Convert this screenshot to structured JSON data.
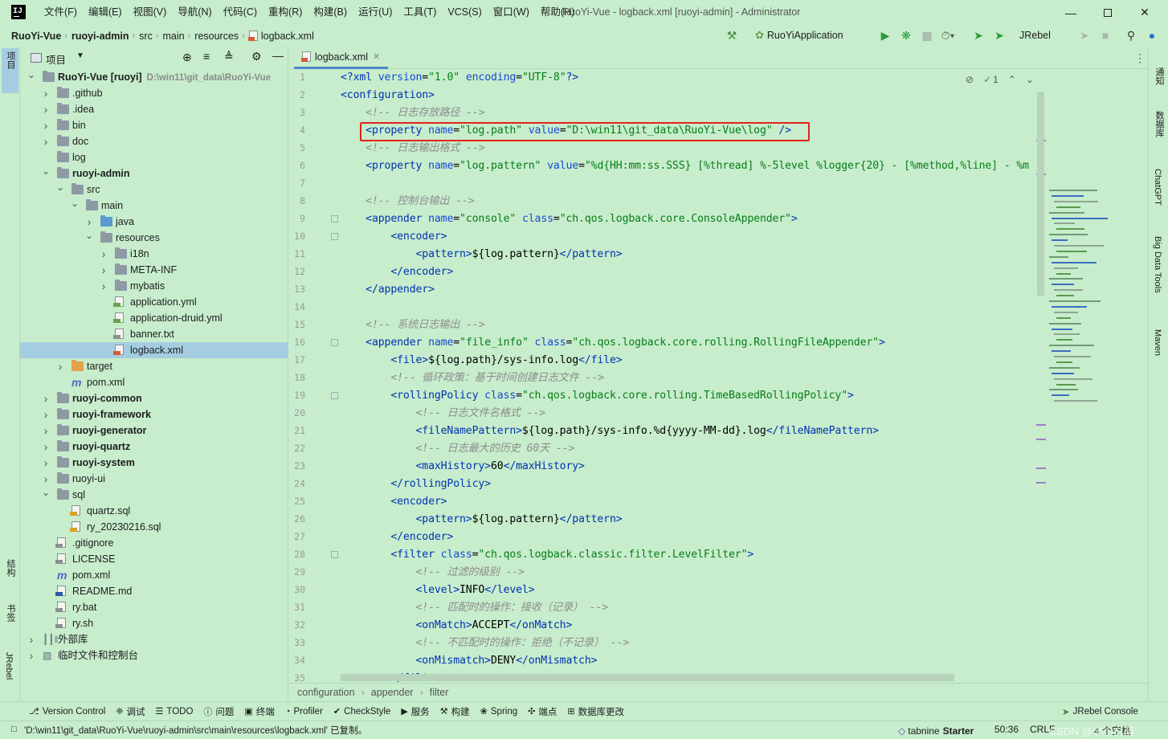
{
  "title_bar": {
    "menus": [
      "文件(F)",
      "编辑(E)",
      "视图(V)",
      "导航(N)",
      "代码(C)",
      "重构(R)",
      "构建(B)",
      "运行(U)",
      "工具(T)",
      "VCS(S)",
      "窗口(W)",
      "帮助(H)"
    ],
    "window_title": "RuoYi-Vue - logback.xml [ruoyi-admin] - Administrator"
  },
  "nav": {
    "crumbs": [
      "RuoYi-Vue",
      "ruoyi-admin",
      "src",
      "main",
      "resources",
      "logback.xml"
    ],
    "run_config": "RuoYiApplication",
    "jrebel_label": "JRebel"
  },
  "left_stripe": [
    "项目",
    "结构",
    "书签",
    "JRebel"
  ],
  "right_stripe": [
    "通知",
    "数据库",
    "ChatGPT",
    "Big Data Tools",
    "Maven"
  ],
  "project": {
    "header_label": "项目",
    "tree": [
      {
        "label": "RuoYi-Vue [ruoyi]",
        "path": "D:\\win11\\git_data\\RuoYi-Vue",
        "bold": true
      },
      {
        "label": ".github"
      },
      {
        "label": ".idea"
      },
      {
        "label": "bin"
      },
      {
        "label": "doc"
      },
      {
        "label": "log"
      },
      {
        "label": "ruoyi-admin",
        "bold": true
      },
      {
        "label": "src"
      },
      {
        "label": "main"
      },
      {
        "label": "java"
      },
      {
        "label": "resources"
      },
      {
        "label": "i18n"
      },
      {
        "label": "META-INF"
      },
      {
        "label": "mybatis"
      },
      {
        "label": "application.yml"
      },
      {
        "label": "application-druid.yml"
      },
      {
        "label": "banner.txt"
      },
      {
        "label": "logback.xml"
      },
      {
        "label": "target"
      },
      {
        "label": "pom.xml"
      },
      {
        "label": "ruoyi-common",
        "bold": true
      },
      {
        "label": "ruoyi-framework",
        "bold": true
      },
      {
        "label": "ruoyi-generator",
        "bold": true
      },
      {
        "label": "ruoyi-quartz",
        "bold": true
      },
      {
        "label": "ruoyi-system",
        "bold": true
      },
      {
        "label": "ruoyi-ui"
      },
      {
        "label": "sql"
      },
      {
        "label": "quartz.sql"
      },
      {
        "label": "ry_20230216.sql"
      },
      {
        "label": ".gitignore"
      },
      {
        "label": "LICENSE"
      },
      {
        "label": "pom.xml"
      },
      {
        "label": "README.md"
      },
      {
        "label": "ry.bat"
      },
      {
        "label": "ry.sh"
      },
      {
        "label": "外部库"
      },
      {
        "label": "临时文件和控制台"
      }
    ]
  },
  "editor": {
    "tab_label": "logback.xml",
    "inspection_count": "1",
    "line_numbers": [
      "1",
      "2",
      "3",
      "4",
      "5",
      "6",
      "7",
      "8",
      "9",
      "10",
      "11",
      "12",
      "13",
      "14",
      "15",
      "16",
      "17",
      "18",
      "19",
      "20",
      "21",
      "22",
      "23",
      "24",
      "25",
      "26",
      "27",
      "28",
      "29",
      "30",
      "31",
      "32",
      "33",
      "34",
      "35"
    ],
    "breadcrumb": [
      "configuration",
      "appender",
      "filter"
    ]
  },
  "code": [
    [
      [
        "p",
        "<?xml "
      ],
      [
        "a",
        "version"
      ],
      [
        "x",
        "="
      ],
      [
        "v",
        "\"1.0\""
      ],
      [
        "x",
        " "
      ],
      [
        "a",
        "encoding"
      ],
      [
        "x",
        "="
      ],
      [
        "v",
        "\"UTF-8\""
      ],
      [
        "p",
        "?>"
      ]
    ],
    [
      [
        "t",
        "<configuration>"
      ]
    ],
    [
      [
        "x",
        "    "
      ],
      [
        "c",
        "<!-- 日志存放路径 -->"
      ]
    ],
    [
      [
        "x",
        "    "
      ],
      [
        "t",
        "<property "
      ],
      [
        "a",
        "name"
      ],
      [
        "x",
        "="
      ],
      [
        "v",
        "\"log.path\""
      ],
      [
        "x",
        " "
      ],
      [
        "a",
        "value"
      ],
      [
        "x",
        "="
      ],
      [
        "v",
        "\"D:\\win11\\git_data\\RuoYi-Vue\\log\""
      ],
      [
        "x",
        " "
      ],
      [
        "t",
        "/>"
      ]
    ],
    [
      [
        "x",
        "    "
      ],
      [
        "c",
        "<!-- 日志输出格式 -->"
      ]
    ],
    [
      [
        "x",
        "    "
      ],
      [
        "t",
        "<property "
      ],
      [
        "a",
        "name"
      ],
      [
        "x",
        "="
      ],
      [
        "v",
        "\"log.pattern\""
      ],
      [
        "x",
        " "
      ],
      [
        "a",
        "value"
      ],
      [
        "x",
        "="
      ],
      [
        "v",
        "\"%d{HH:mm:ss.SSS} [%thread] %-5level %logger{20} - [%method,%line] - %m"
      ]
    ],
    [
      [
        "x",
        ""
      ]
    ],
    [
      [
        "x",
        "    "
      ],
      [
        "c",
        "<!-- 控制台输出 -->"
      ]
    ],
    [
      [
        "x",
        "    "
      ],
      [
        "t",
        "<appender "
      ],
      [
        "a",
        "name"
      ],
      [
        "x",
        "="
      ],
      [
        "v",
        "\"console\""
      ],
      [
        "x",
        " "
      ],
      [
        "a",
        "class"
      ],
      [
        "x",
        "="
      ],
      [
        "v",
        "\"ch.qos.logback.core.ConsoleAppender\""
      ],
      [
        "t",
        ">"
      ]
    ],
    [
      [
        "x",
        "        "
      ],
      [
        "t",
        "<encoder>"
      ]
    ],
    [
      [
        "x",
        "            "
      ],
      [
        "t",
        "<pattern>"
      ],
      [
        "x",
        "${log.pattern}"
      ],
      [
        "t",
        "</pattern>"
      ]
    ],
    [
      [
        "x",
        "        "
      ],
      [
        "t",
        "</encoder>"
      ]
    ],
    [
      [
        "x",
        "    "
      ],
      [
        "t",
        "</appender>"
      ]
    ],
    [
      [
        "x",
        ""
      ]
    ],
    [
      [
        "x",
        "    "
      ],
      [
        "c",
        "<!-- 系统日志输出 -->"
      ]
    ],
    [
      [
        "x",
        "    "
      ],
      [
        "t",
        "<appender "
      ],
      [
        "a",
        "name"
      ],
      [
        "x",
        "="
      ],
      [
        "v",
        "\"file_info\""
      ],
      [
        "x",
        " "
      ],
      [
        "a",
        "class"
      ],
      [
        "x",
        "="
      ],
      [
        "v",
        "\"ch.qos.logback.core.rolling.RollingFileAppender\""
      ],
      [
        "t",
        ">"
      ]
    ],
    [
      [
        "x",
        "        "
      ],
      [
        "t",
        "<file>"
      ],
      [
        "x",
        "${log.path}/sys-info.log"
      ],
      [
        "t",
        "</file>"
      ]
    ],
    [
      [
        "x",
        "        "
      ],
      [
        "c",
        "<!-- 循环政策：基于时间创建日志文件 -->"
      ]
    ],
    [
      [
        "x",
        "        "
      ],
      [
        "t",
        "<rollingPolicy "
      ],
      [
        "a",
        "class"
      ],
      [
        "x",
        "="
      ],
      [
        "v",
        "\"ch.qos.logback.core.rolling.TimeBasedRollingPolicy\""
      ],
      [
        "t",
        ">"
      ]
    ],
    [
      [
        "x",
        "            "
      ],
      [
        "c",
        "<!-- 日志文件名格式 -->"
      ]
    ],
    [
      [
        "x",
        "            "
      ],
      [
        "t",
        "<fileNamePattern>"
      ],
      [
        "x",
        "${log.path}/sys-info.%d{yyyy-MM-dd}.log"
      ],
      [
        "t",
        "</fileNamePattern>"
      ]
    ],
    [
      [
        "x",
        "            "
      ],
      [
        "c",
        "<!-- 日志最大的历史 60天 -->"
      ]
    ],
    [
      [
        "x",
        "            "
      ],
      [
        "t",
        "<maxHistory>"
      ],
      [
        "x",
        "60"
      ],
      [
        "t",
        "</maxHistory>"
      ]
    ],
    [
      [
        "x",
        "        "
      ],
      [
        "t",
        "</rollingPolicy>"
      ]
    ],
    [
      [
        "x",
        "        "
      ],
      [
        "t",
        "<encoder>"
      ]
    ],
    [
      [
        "x",
        "            "
      ],
      [
        "t",
        "<pattern>"
      ],
      [
        "x",
        "${log.pattern}"
      ],
      [
        "t",
        "</pattern>"
      ]
    ],
    [
      [
        "x",
        "        "
      ],
      [
        "t",
        "</encoder>"
      ]
    ],
    [
      [
        "x",
        "        "
      ],
      [
        "t",
        "<filter "
      ],
      [
        "a",
        "class"
      ],
      [
        "x",
        "="
      ],
      [
        "v",
        "\"ch.qos.logback.classic.filter.LevelFilter\""
      ],
      [
        "t",
        ">"
      ]
    ],
    [
      [
        "x",
        "            "
      ],
      [
        "c",
        "<!-- 过滤的级别 -->"
      ]
    ],
    [
      [
        "x",
        "            "
      ],
      [
        "t",
        "<level>"
      ],
      [
        "x",
        "INFO"
      ],
      [
        "t",
        "</level>"
      ]
    ],
    [
      [
        "x",
        "            "
      ],
      [
        "c",
        "<!-- 匹配时的操作：接收（记录） -->"
      ]
    ],
    [
      [
        "x",
        "            "
      ],
      [
        "t",
        "<onMatch>"
      ],
      [
        "x",
        "ACCEPT"
      ],
      [
        "t",
        "</onMatch>"
      ]
    ],
    [
      [
        "x",
        "            "
      ],
      [
        "c",
        "<!-- 不匹配时的操作：拒绝（不记录） -->"
      ]
    ],
    [
      [
        "x",
        "            "
      ],
      [
        "t",
        "<onMismatch>"
      ],
      [
        "x",
        "DENY"
      ],
      [
        "t",
        "</onMismatch>"
      ]
    ],
    [
      [
        "x",
        "        "
      ],
      [
        "t",
        "</filter>"
      ]
    ]
  ],
  "bottom_tools": [
    {
      "icon": "version-control-icon",
      "label": "Version Control"
    },
    {
      "icon": "debug-icon",
      "label": "调试"
    },
    {
      "icon": "todo-icon",
      "label": "TODO"
    },
    {
      "icon": "problems-icon",
      "label": "问题"
    },
    {
      "icon": "terminal-icon",
      "label": "终端"
    },
    {
      "icon": "profiler-icon",
      "label": "Profiler"
    },
    {
      "icon": "checkstyle-icon",
      "label": "CheckStyle"
    },
    {
      "icon": "services-icon",
      "label": "服务"
    },
    {
      "icon": "build-icon",
      "label": "构建"
    },
    {
      "icon": "spring-icon",
      "label": "Spring"
    },
    {
      "icon": "endpoints-icon",
      "label": "端点"
    },
    {
      "icon": "database-changes-icon",
      "label": "数据库更改"
    }
  ],
  "jrebel_console": "JRebel Console",
  "status": {
    "message": "'D:\\win11\\git_data\\RuoYi-Vue\\ruoyi-admin\\src\\main\\resources\\logback.xml' 已复制。",
    "tabnine": "tabnine",
    "tabnine_plan": "Starter",
    "position": "50:36",
    "line_sep": "CRLF",
    "indent": "4 个空格",
    "watermark": "CSDN @李小白萌"
  }
}
